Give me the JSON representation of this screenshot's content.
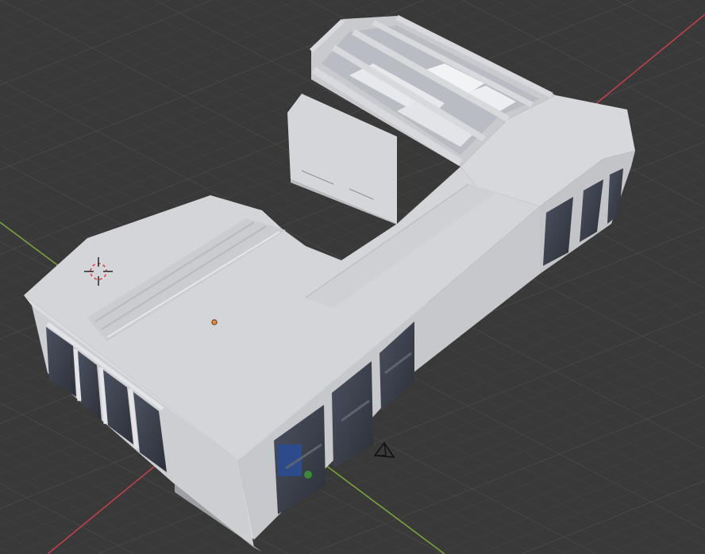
{
  "viewport": {
    "background_color": "#393939",
    "grid_color": "#4a4a4a",
    "x_axis_color": "#c0404a",
    "y_axis_color": "#7aa23c"
  },
  "scene": {
    "model": {
      "top_color": "#d3d4d8",
      "wall_light_color": "#dcdde1",
      "wall_mid_color": "#c6c7cb",
      "wall_dark_color": "#aeafb4",
      "glass_color": "#3b404a"
    },
    "origin_dot_color": "#e98a2e",
    "icons": [
      "3d-cursor-icon",
      "object-origin-icon",
      "camera-icon"
    ]
  }
}
